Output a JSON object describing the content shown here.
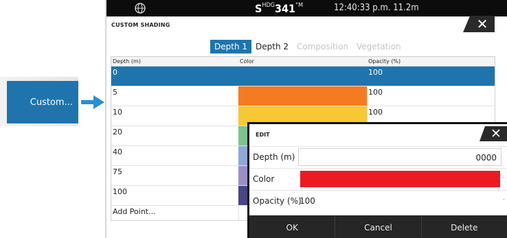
{
  "callout": {
    "button_label": "Custom..."
  },
  "status_bar": {
    "globe_icon": "globe-icon",
    "heading_prefix": "S",
    "heading_label": "HDG",
    "heading_value": "341",
    "heading_unit": "°M",
    "time": "12:40:33 p.m.",
    "depth": "11.2m"
  },
  "dialog_title": "CUSTOM SHADING",
  "tabs": [
    {
      "label": "Depth 1",
      "state": "active"
    },
    {
      "label": "Depth 2",
      "state": "normal"
    },
    {
      "label": "Composition",
      "state": "disabled"
    },
    {
      "label": "Vegetation",
      "state": "disabled"
    }
  ],
  "table": {
    "headers": {
      "depth": "Depth (m)",
      "color": "Color",
      "opacity": "Opacity (%)"
    },
    "rows": [
      {
        "depth": "0",
        "color": "#1f74ad",
        "opacity": "100",
        "selected": true
      },
      {
        "depth": "5",
        "color": "#f57b20",
        "opacity": "100",
        "selected": false
      },
      {
        "depth": "10",
        "color": "#f7c832",
        "opacity": "100",
        "selected": false
      },
      {
        "depth": "20",
        "color": "#7cc38f",
        "opacity": "",
        "selected": false
      },
      {
        "depth": "40",
        "color": "#8fa8d8",
        "opacity": "",
        "selected": false
      },
      {
        "depth": "75",
        "color": "#9a90c8",
        "opacity": "",
        "selected": false
      },
      {
        "depth": "100",
        "color": "#4a4685",
        "opacity": "",
        "selected": false
      }
    ],
    "add_point_label": "Add Point..."
  },
  "edit_dialog": {
    "title": "EDIT",
    "depth_label": "Depth (m)",
    "depth_value": "0000",
    "color_label": "Color",
    "color_value": "#ec1b23",
    "opacity_label": "Opacity (%)",
    "opacity_value": "100",
    "buttons": {
      "ok": "OK",
      "cancel": "Cancel",
      "delete": "Delete"
    }
  },
  "colors": {
    "accent": "#1f74ad",
    "status_bar": "#0c0c0c",
    "footer": "#262626"
  }
}
